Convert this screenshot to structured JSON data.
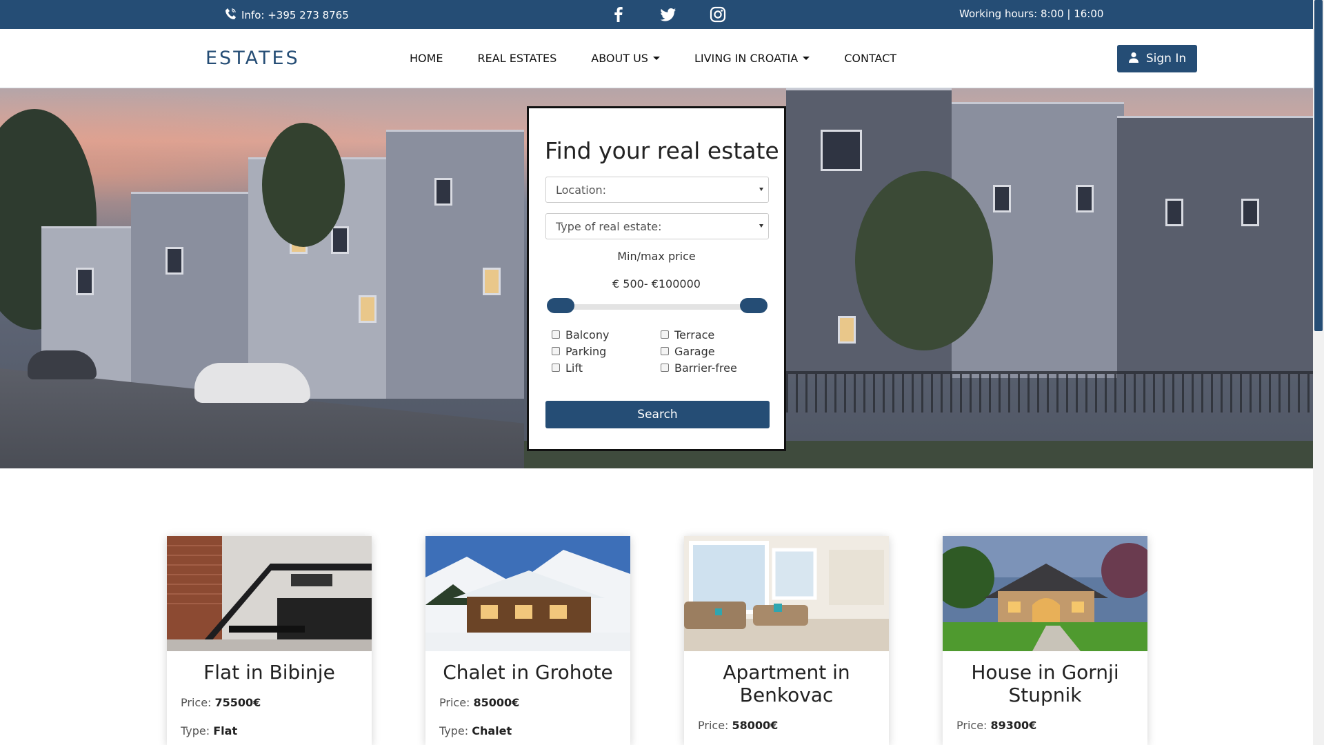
{
  "topbar": {
    "info": "Info: +395 273 8765",
    "hours": "Working hours: 8:00 | 16:00",
    "icons": [
      "phone-icon",
      "facebook-icon",
      "twitter-icon",
      "instagram-icon"
    ]
  },
  "navbar": {
    "brand": "ESTATES",
    "items": [
      "HOME",
      "REAL ESTATES",
      "ABOUT US",
      "LIVING IN CROATIA",
      "CONTACT"
    ],
    "signin": "Sign In"
  },
  "search": {
    "title": "Find your real estate",
    "location": "Location:",
    "type": "Type of real estate:",
    "price_title": "Min/max price",
    "price_range": "€ 500- €100000",
    "price_min": 500,
    "price_max": 100000,
    "features": [
      "Balcony",
      "Terrace",
      "Parking",
      "Garage",
      "Lift",
      "Barrier-free"
    ],
    "button": "Search"
  },
  "listings": [
    {
      "title": "Flat in Bibinje",
      "price_label": "Price:",
      "price": "75500€",
      "type_label": "Type:",
      "type": "Flat"
    },
    {
      "title": "Chalet in Grohote",
      "price_label": "Price:",
      "price": "85000€",
      "type_label": "Type:",
      "type": "Chalet"
    },
    {
      "title": "Apartment in Benkovac",
      "price_label": "Price:",
      "price": "58000€"
    },
    {
      "title": "House in Gornji Stupnik",
      "price_label": "Price:",
      "price": "89300€"
    }
  ],
  "colors": {
    "brand": "#254d75",
    "background": "#ffffff",
    "text": "#222222"
  }
}
